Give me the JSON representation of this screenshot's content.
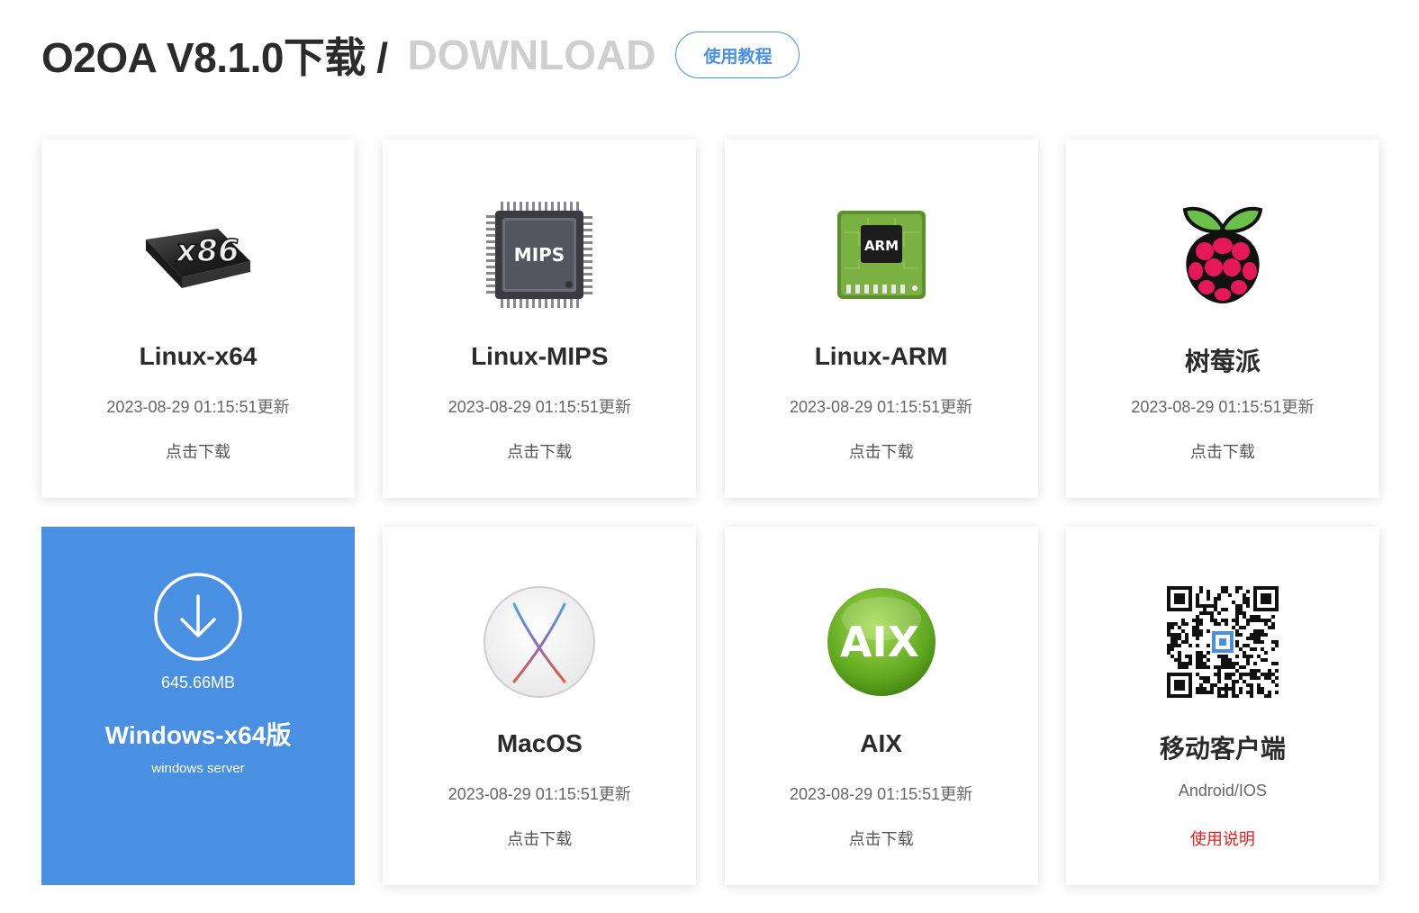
{
  "header": {
    "title": "O2OA V8.1.0下载 /",
    "subtitle": "DOWNLOAD",
    "tutorial_label": "使用教程"
  },
  "colors": {
    "accent": "#4a90e2",
    "note_red": "#e02020"
  },
  "cards": [
    {
      "name": "Linux-x64",
      "date": "2023-08-29 01:15:51更新",
      "action": "点击下载",
      "icon": "x86-chip-icon",
      "icon_text": "x86"
    },
    {
      "name": "Linux-MIPS",
      "date": "2023-08-29 01:15:51更新",
      "action": "点击下载",
      "icon": "mips-chip-icon",
      "icon_text": "MIPS"
    },
    {
      "name": "Linux-ARM",
      "date": "2023-08-29 01:15:51更新",
      "action": "点击下载",
      "icon": "arm-chip-icon",
      "icon_text": "ARM"
    },
    {
      "name": "树莓派",
      "date": "2023-08-29 01:15:51更新",
      "action": "点击下载",
      "icon": "raspberry-pi-icon"
    },
    {
      "name": "Windows-x64版",
      "size": "645.66MB",
      "sub": "windows server",
      "icon": "download-circle-icon"
    },
    {
      "name": "MacOS",
      "date": "2023-08-29 01:15:51更新",
      "action": "点击下载",
      "icon": "macos-x-icon"
    },
    {
      "name": "AIX",
      "date": "2023-08-29 01:15:51更新",
      "action": "点击下载",
      "icon": "aix-logo-icon",
      "icon_text": "AIX"
    },
    {
      "name": "移动客户端",
      "date": "Android/IOS",
      "action": "使用说明",
      "icon": "qr-code-icon"
    }
  ]
}
